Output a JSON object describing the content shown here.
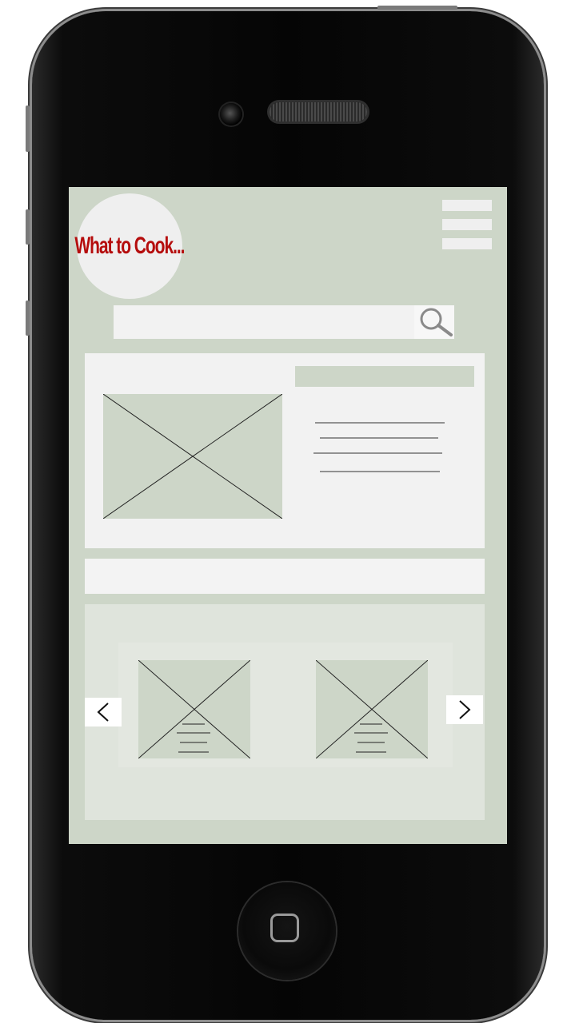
{
  "app": {
    "logo_text": "What to Cook..."
  },
  "colors": {
    "screen_bg": "#cdd6c8",
    "panel_bg": "#f2f2f2",
    "logo_red": "#b50d0d",
    "carousel_bg": "#dfe4dc"
  },
  "icons": {
    "menu": "hamburger-menu-icon",
    "search": "magnifier-icon",
    "prev": "chevron-left-icon",
    "next": "chevron-right-icon",
    "placeholder": "image-placeholder-icon"
  },
  "search": {
    "value": "",
    "placeholder": ""
  },
  "carousel": {
    "prev_label": "<",
    "next_label": ">"
  }
}
